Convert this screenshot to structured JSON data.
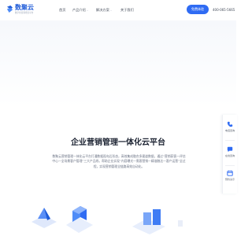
{
  "brand": {
    "name": "数聚云",
    "tagline": "数字化营销增长平台",
    "color": "#1f5bd8"
  },
  "nav": {
    "items": [
      {
        "label": "首页"
      },
      {
        "label": "产品介绍",
        "has_dropdown": true
      },
      {
        "label": "解决方案",
        "has_dropdown": true
      },
      {
        "label": "关于我们"
      }
    ],
    "cta_label": "免费体验",
    "phone": "400-065-5665"
  },
  "hero": {
    "title": "企业营销管理一体化云平台",
    "description": "数聚云营销管理一体化云平台打通数据孤岛后形态，高效集成融合多渠道数据，通过“营销获客一评估中心一全场景客户管理”三大产品线，帮助企业实现“内容曝光一需客营销一精准触达一客户运营”全过程，实现营销管理全链路高效自动化。"
  },
  "side_panel": {
    "items": [
      {
        "label": "电话咨询",
        "icon": "phone-icon"
      },
      {
        "label": "在线咨询",
        "icon": "chat-icon"
      },
      {
        "label": "预约演示",
        "icon": "calendar-icon"
      }
    ]
  },
  "colors": {
    "primary": "#2f6bf3",
    "title": "#1d2433",
    "text": "#6b7385"
  }
}
